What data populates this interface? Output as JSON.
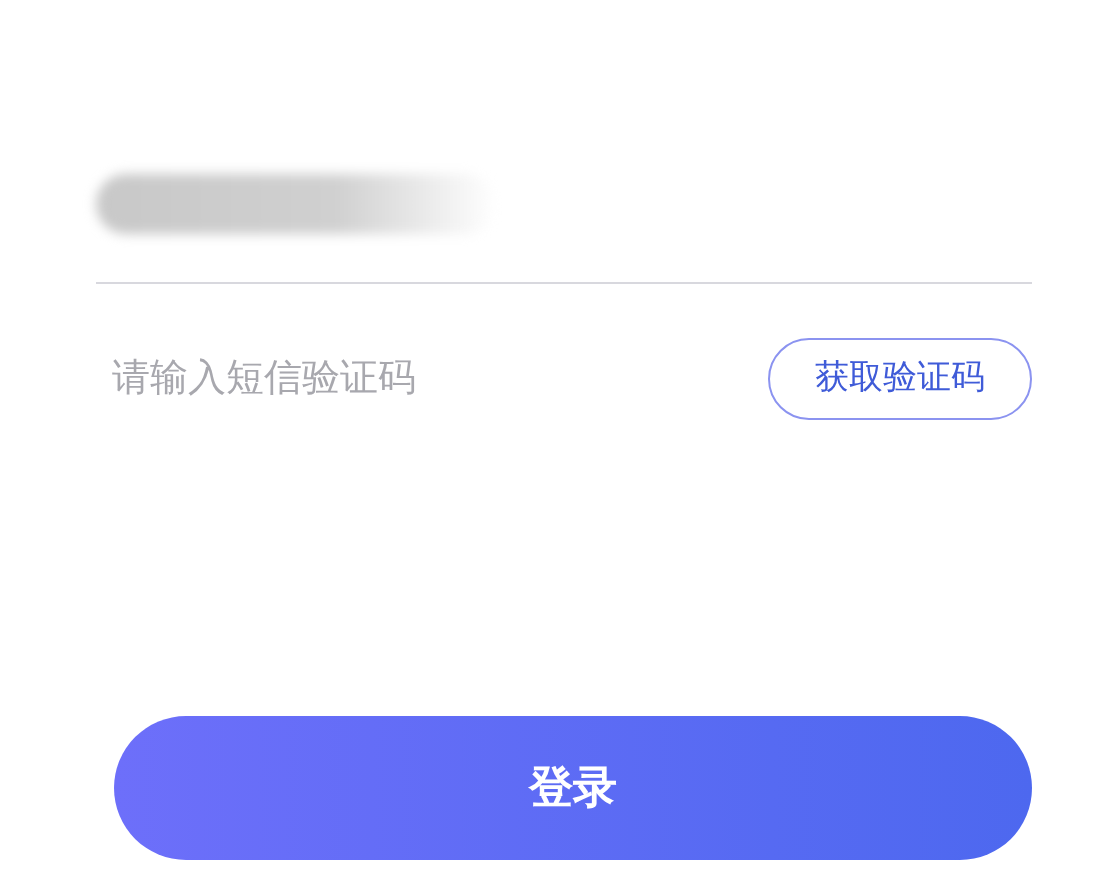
{
  "phone_field": {
    "kind": "redacted"
  },
  "code_field": {
    "placeholder": "请输入短信验证码"
  },
  "get_code_button": {
    "label": "获取验证码"
  },
  "login_button": {
    "label": "登录"
  }
}
